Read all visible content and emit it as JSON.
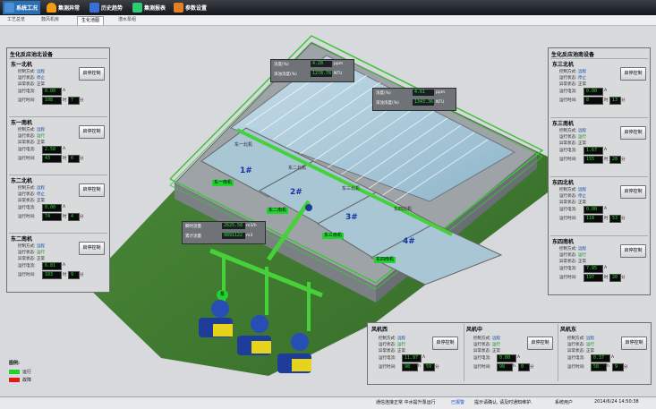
{
  "toolbar": {
    "items": [
      {
        "label": "系统工况",
        "color": "#4a90d9"
      },
      {
        "label": "集测异常",
        "color": "#f39c12"
      },
      {
        "label": "历史趋势",
        "color": "#3a6fd8"
      },
      {
        "label": "集测报表",
        "color": "#2ecc71"
      },
      {
        "label": "参数设置",
        "color": "#e67e22"
      }
    ]
  },
  "subtabs": [
    "工艺总览",
    "鼓风机房",
    "生化池图",
    "潜水泵组"
  ],
  "north_panel": {
    "title": "生化反应池北设备",
    "button_label": "启停控制",
    "labels": {
      "mode": "控制方式:",
      "state": "运行状态:",
      "fault": "异常状态:",
      "current": "运行电流:",
      "runtime": "运行时间:"
    },
    "units": {
      "a": "A",
      "h": "时",
      "m": "分"
    },
    "units_short": {
      "h": "h",
      "m": "分"
    },
    "machines": [
      {
        "name": "东一北机",
        "mode": "远程",
        "state": "停止",
        "fault": "正常",
        "current": "0.00",
        "hours": "108",
        "minutes": "7"
      },
      {
        "name": "东一南机",
        "mode": "远程",
        "state": "运行",
        "fault": "正常",
        "current": "2.58",
        "hours": "43",
        "minutes": "0"
      },
      {
        "name": "东二北机",
        "mode": "远程",
        "state": "停止",
        "fault": "正常",
        "current": "0.00",
        "hours": "74",
        "minutes": "4"
      },
      {
        "name": "东二南机",
        "mode": "远程",
        "state": "运行",
        "fault": "正常",
        "current": "6.81",
        "hours": "183",
        "minutes": "9"
      }
    ]
  },
  "south_panel": {
    "title": "生化反应池南设备",
    "button_label": "启停控制",
    "labels": {
      "mode": "控制方式:",
      "state": "运行状态:",
      "fault": "异常状态:",
      "current": "运行电流:",
      "runtime": "运行时间:"
    },
    "machines": [
      {
        "name": "东三北机",
        "mode": "远程",
        "state": "停止",
        "fault": "正常",
        "current": "0.00",
        "hours": "8",
        "minutes": "13"
      },
      {
        "name": "东三南机",
        "mode": "远程",
        "state": "运行",
        "fault": "正常",
        "current": "1.67",
        "hours": "155",
        "minutes": "28"
      },
      {
        "name": "东四北机",
        "mode": "远程",
        "state": "停止",
        "fault": "正常",
        "current": "0.00",
        "hours": "118",
        "minutes": "53"
      },
      {
        "name": "东四南机",
        "mode": "远程",
        "state": "运行",
        "fault": "正常",
        "current": "7.95",
        "hours": "197",
        "minutes": "20"
      }
    ]
  },
  "overlay_top": {
    "label1": "浓度(%)",
    "value1": "4.28",
    "unit1": "ppm",
    "label2": "浑浊浓度(%)",
    "value2": "1278.78",
    "unit2": "NTU"
  },
  "overlay_mid": {
    "label1": "浓度(%)",
    "value1": "4.61",
    "unit1": "ppm",
    "label2": "浑浊浓度(%)",
    "value2": "1343.36",
    "unit2": "NTU"
  },
  "overlay_flow": {
    "label1": "瞬时流量",
    "value1": "2625.58",
    "unit1": "m3/h",
    "label2": "累计流量",
    "value2": "9891122",
    "unit2": "m3"
  },
  "pool_labels": [
    "东一北机",
    "东二北机",
    "东三北机",
    "东四北机"
  ],
  "pool_green_labels": [
    "东一南机",
    "东二南机",
    "东三南机",
    "东四南机"
  ],
  "pool_numbers": [
    "1#",
    "2#",
    "3#",
    "4#"
  ],
  "pump_badge": "泵",
  "fans": [
    {
      "name": "风机西",
      "mode": "远程",
      "state": "运行",
      "fault": "正常",
      "current": "11.97",
      "hours": "98",
      "minutes": "59"
    },
    {
      "name": "风机中",
      "mode": "远程",
      "state": "运行",
      "fault": "正常",
      "current": "0.00",
      "hours": "98",
      "minutes": "0"
    },
    {
      "name": "风机东",
      "mode": "远程",
      "state": "运行",
      "fault": "正常",
      "current": "0.37",
      "hours": "58",
      "minutes": "9"
    }
  ],
  "fan_button": "启停控制",
  "legend": {
    "title": "图例:",
    "items": [
      {
        "label": "运行",
        "color": "#1fd32a"
      },
      {
        "label": "故障",
        "color": "#e01a1a"
      }
    ]
  },
  "statusbar": {
    "left": "通信连接正常 中水提升泵运行",
    "alarm_prefix": "已报警",
    "alarm_text": "提示请确认, 请及时通知维护.",
    "user": "系统用户",
    "datetime": "2014/6/24 14:50:38"
  }
}
